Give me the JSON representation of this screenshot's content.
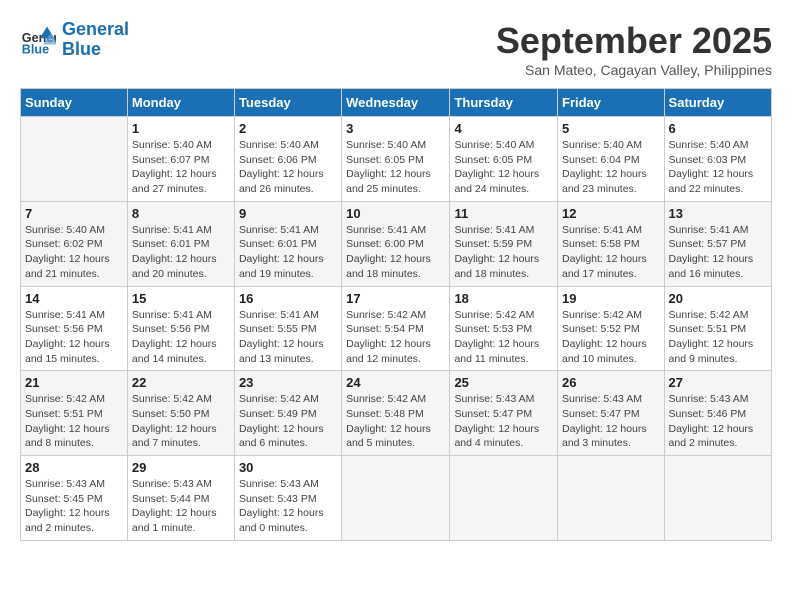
{
  "header": {
    "logo_line1": "General",
    "logo_line2": "Blue",
    "month": "September 2025",
    "location": "San Mateo, Cagayan Valley, Philippines"
  },
  "weekdays": [
    "Sunday",
    "Monday",
    "Tuesday",
    "Wednesday",
    "Thursday",
    "Friday",
    "Saturday"
  ],
  "weeks": [
    [
      {
        "day": "",
        "info": ""
      },
      {
        "day": "1",
        "info": "Sunrise: 5:40 AM\nSunset: 6:07 PM\nDaylight: 12 hours\nand 27 minutes."
      },
      {
        "day": "2",
        "info": "Sunrise: 5:40 AM\nSunset: 6:06 PM\nDaylight: 12 hours\nand 26 minutes."
      },
      {
        "day": "3",
        "info": "Sunrise: 5:40 AM\nSunset: 6:05 PM\nDaylight: 12 hours\nand 25 minutes."
      },
      {
        "day": "4",
        "info": "Sunrise: 5:40 AM\nSunset: 6:05 PM\nDaylight: 12 hours\nand 24 minutes."
      },
      {
        "day": "5",
        "info": "Sunrise: 5:40 AM\nSunset: 6:04 PM\nDaylight: 12 hours\nand 23 minutes."
      },
      {
        "day": "6",
        "info": "Sunrise: 5:40 AM\nSunset: 6:03 PM\nDaylight: 12 hours\nand 22 minutes."
      }
    ],
    [
      {
        "day": "7",
        "info": "Sunrise: 5:40 AM\nSunset: 6:02 PM\nDaylight: 12 hours\nand 21 minutes."
      },
      {
        "day": "8",
        "info": "Sunrise: 5:41 AM\nSunset: 6:01 PM\nDaylight: 12 hours\nand 20 minutes."
      },
      {
        "day": "9",
        "info": "Sunrise: 5:41 AM\nSunset: 6:01 PM\nDaylight: 12 hours\nand 19 minutes."
      },
      {
        "day": "10",
        "info": "Sunrise: 5:41 AM\nSunset: 6:00 PM\nDaylight: 12 hours\nand 18 minutes."
      },
      {
        "day": "11",
        "info": "Sunrise: 5:41 AM\nSunset: 5:59 PM\nDaylight: 12 hours\nand 18 minutes."
      },
      {
        "day": "12",
        "info": "Sunrise: 5:41 AM\nSunset: 5:58 PM\nDaylight: 12 hours\nand 17 minutes."
      },
      {
        "day": "13",
        "info": "Sunrise: 5:41 AM\nSunset: 5:57 PM\nDaylight: 12 hours\nand 16 minutes."
      }
    ],
    [
      {
        "day": "14",
        "info": "Sunrise: 5:41 AM\nSunset: 5:56 PM\nDaylight: 12 hours\nand 15 minutes."
      },
      {
        "day": "15",
        "info": "Sunrise: 5:41 AM\nSunset: 5:56 PM\nDaylight: 12 hours\nand 14 minutes."
      },
      {
        "day": "16",
        "info": "Sunrise: 5:41 AM\nSunset: 5:55 PM\nDaylight: 12 hours\nand 13 minutes."
      },
      {
        "day": "17",
        "info": "Sunrise: 5:42 AM\nSunset: 5:54 PM\nDaylight: 12 hours\nand 12 minutes."
      },
      {
        "day": "18",
        "info": "Sunrise: 5:42 AM\nSunset: 5:53 PM\nDaylight: 12 hours\nand 11 minutes."
      },
      {
        "day": "19",
        "info": "Sunrise: 5:42 AM\nSunset: 5:52 PM\nDaylight: 12 hours\nand 10 minutes."
      },
      {
        "day": "20",
        "info": "Sunrise: 5:42 AM\nSunset: 5:51 PM\nDaylight: 12 hours\nand 9 minutes."
      }
    ],
    [
      {
        "day": "21",
        "info": "Sunrise: 5:42 AM\nSunset: 5:51 PM\nDaylight: 12 hours\nand 8 minutes."
      },
      {
        "day": "22",
        "info": "Sunrise: 5:42 AM\nSunset: 5:50 PM\nDaylight: 12 hours\nand 7 minutes."
      },
      {
        "day": "23",
        "info": "Sunrise: 5:42 AM\nSunset: 5:49 PM\nDaylight: 12 hours\nand 6 minutes."
      },
      {
        "day": "24",
        "info": "Sunrise: 5:42 AM\nSunset: 5:48 PM\nDaylight: 12 hours\nand 5 minutes."
      },
      {
        "day": "25",
        "info": "Sunrise: 5:43 AM\nSunset: 5:47 PM\nDaylight: 12 hours\nand 4 minutes."
      },
      {
        "day": "26",
        "info": "Sunrise: 5:43 AM\nSunset: 5:47 PM\nDaylight: 12 hours\nand 3 minutes."
      },
      {
        "day": "27",
        "info": "Sunrise: 5:43 AM\nSunset: 5:46 PM\nDaylight: 12 hours\nand 2 minutes."
      }
    ],
    [
      {
        "day": "28",
        "info": "Sunrise: 5:43 AM\nSunset: 5:45 PM\nDaylight: 12 hours\nand 2 minutes."
      },
      {
        "day": "29",
        "info": "Sunrise: 5:43 AM\nSunset: 5:44 PM\nDaylight: 12 hours\nand 1 minute."
      },
      {
        "day": "30",
        "info": "Sunrise: 5:43 AM\nSunset: 5:43 PM\nDaylight: 12 hours\nand 0 minutes."
      },
      {
        "day": "",
        "info": ""
      },
      {
        "day": "",
        "info": ""
      },
      {
        "day": "",
        "info": ""
      },
      {
        "day": "",
        "info": ""
      }
    ]
  ]
}
